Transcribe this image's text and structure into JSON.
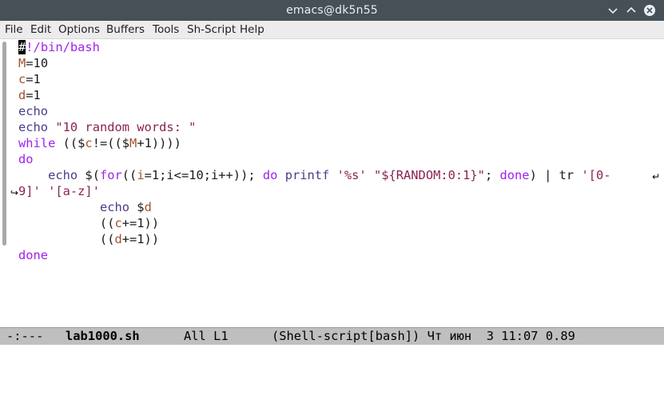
{
  "window": {
    "title": "emacs@dk5n55"
  },
  "menu": [
    "File",
    "Edit",
    "Options",
    "Buffers",
    "Tools",
    "Sh-Script",
    "Help"
  ],
  "editor": {
    "lines": [
      {
        "segments": [
          {
            "text": "#",
            "cls": "cursor"
          },
          {
            "text": "!/bin/bash",
            "cls": "kw"
          }
        ]
      },
      {
        "segments": [
          {
            "text": "M",
            "cls": "var"
          },
          {
            "text": "=10",
            "cls": ""
          }
        ]
      },
      {
        "segments": [
          {
            "text": "c",
            "cls": "var"
          },
          {
            "text": "=1",
            "cls": ""
          }
        ]
      },
      {
        "segments": [
          {
            "text": "d",
            "cls": "var"
          },
          {
            "text": "=1",
            "cls": ""
          }
        ]
      },
      {
        "segments": [
          {
            "text": "echo",
            "cls": "bi"
          }
        ]
      },
      {
        "segments": [
          {
            "text": "echo",
            "cls": "bi"
          },
          {
            "text": " ",
            "cls": ""
          },
          {
            "text": "\"10 random words: \"",
            "cls": "str"
          }
        ]
      },
      {
        "segments": [
          {
            "text": "while",
            "cls": "kw"
          },
          {
            "text": " (($",
            "cls": ""
          },
          {
            "text": "c",
            "cls": "var"
          },
          {
            "text": "!=(($",
            "cls": ""
          },
          {
            "text": "M",
            "cls": "var"
          },
          {
            "text": "+1))))",
            "cls": ""
          }
        ]
      },
      {
        "segments": [
          {
            "text": "do",
            "cls": "kw"
          }
        ]
      },
      {
        "segments": [
          {
            "text": "    ",
            "cls": ""
          },
          {
            "text": "echo",
            "cls": "bi"
          },
          {
            "text": " $(",
            "cls": ""
          },
          {
            "text": "for",
            "cls": "kw"
          },
          {
            "text": "((",
            "cls": ""
          },
          {
            "text": "i",
            "cls": "var"
          },
          {
            "text": "=1;i<=10;i++)); ",
            "cls": ""
          },
          {
            "text": "do",
            "cls": "kw"
          },
          {
            "text": " ",
            "cls": ""
          },
          {
            "text": "printf",
            "cls": "bi"
          },
          {
            "text": " ",
            "cls": ""
          },
          {
            "text": "'%s'",
            "cls": "str"
          },
          {
            "text": " ",
            "cls": ""
          },
          {
            "text": "\"${RANDOM:0:1}\"",
            "cls": "str"
          },
          {
            "text": "; ",
            "cls": ""
          },
          {
            "text": "done",
            "cls": "kw"
          },
          {
            "text": ") | tr ",
            "cls": ""
          },
          {
            "text": "'[0-",
            "cls": "str"
          }
        ]
      },
      {
        "segments": [
          {
            "text": "9]'",
            "cls": "str"
          },
          {
            "text": " ",
            "cls": ""
          },
          {
            "text": "'[a-z]'",
            "cls": "str"
          }
        ]
      },
      {
        "segments": [
          {
            "text": "           ",
            "cls": ""
          },
          {
            "text": "echo",
            "cls": "bi"
          },
          {
            "text": " $",
            "cls": ""
          },
          {
            "text": "d",
            "cls": "var"
          }
        ]
      },
      {
        "segments": [
          {
            "text": "           ((",
            "cls": ""
          },
          {
            "text": "c",
            "cls": "var"
          },
          {
            "text": "+=1))",
            "cls": ""
          }
        ]
      },
      {
        "segments": [
          {
            "text": "           ((",
            "cls": ""
          },
          {
            "text": "d",
            "cls": "var"
          },
          {
            "text": "+=1))",
            "cls": ""
          }
        ]
      },
      {
        "segments": [
          {
            "text": "done",
            "cls": "kw"
          }
        ]
      }
    ]
  },
  "modeline": {
    "status": "-:---",
    "buffer": "lab1000.sh",
    "position": "All L1",
    "mode_info": "(Shell-script[bash]) Чт июн  3 11:07 0.89"
  }
}
